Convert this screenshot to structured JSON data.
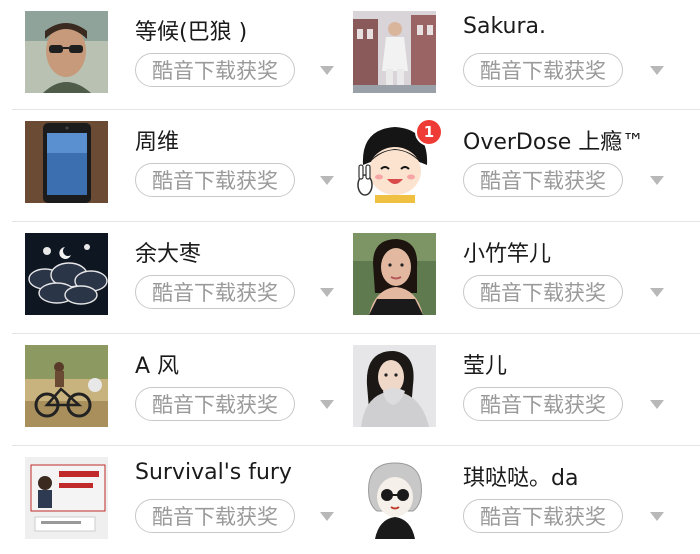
{
  "users": [
    {
      "name": "等候(巴狼 )",
      "tag": "酷音下载获奖",
      "avatar_icon": "man-sunglasses-photo"
    },
    {
      "name": "Sakura.",
      "tag": "酷音下载获奖",
      "avatar_icon": "woman-street-photo"
    },
    {
      "name": "周维",
      "tag": "酷音下载获奖",
      "avatar_icon": "phone-photo"
    },
    {
      "name": "OverDose 上瘾™",
      "tag": "酷音下载获奖",
      "avatar_icon": "cartoon-girl-illustration",
      "badge": "1"
    },
    {
      "name": "余大枣",
      "tag": "酷音下载获奖",
      "avatar_icon": "night-moon-illustration"
    },
    {
      "name": "小竹竿儿",
      "tag": "酷音下载获奖",
      "avatar_icon": "woman-portrait-photo"
    },
    {
      "name": "A 风",
      "tag": "酷音下载获奖",
      "avatar_icon": "bicycle-photo"
    },
    {
      "name": "莹儿",
      "tag": "酷音下载获奖",
      "avatar_icon": "woman-sweater-photo"
    },
    {
      "name": "Survival's fury",
      "tag": "酷音下载获奖",
      "avatar_icon": "man-sign-photo"
    },
    {
      "name": "琪哒哒。da",
      "tag": "酷音下载获奖",
      "avatar_icon": "sketch-girl-illustration"
    }
  ],
  "colors": {
    "tag_border": "#c9c9c9",
    "tag_text": "#9a9a9a",
    "badge": "#ef3b36",
    "divider": "#e4e4e4"
  }
}
